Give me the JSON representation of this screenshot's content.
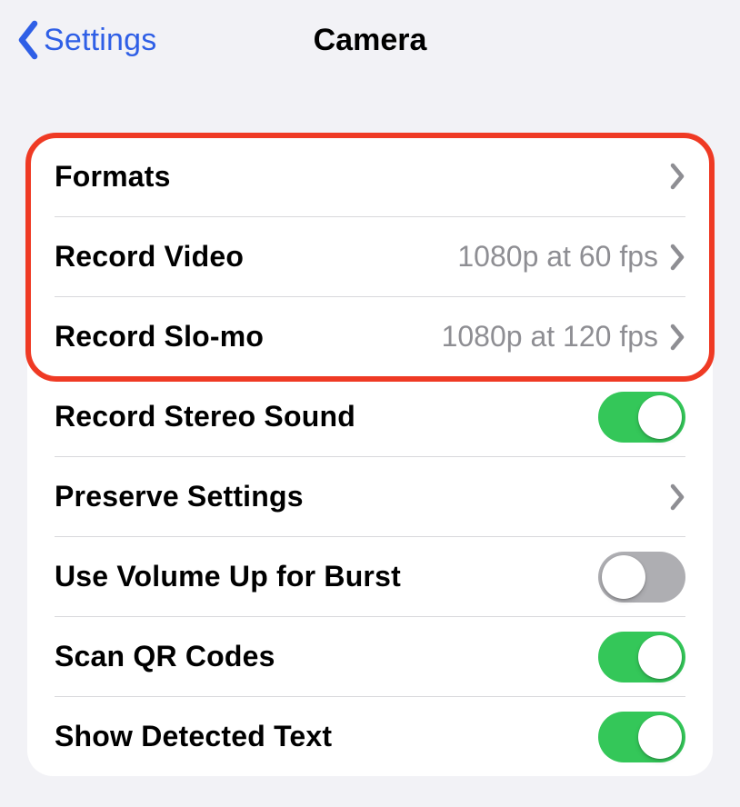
{
  "navbar": {
    "back_label": "Settings",
    "title": "Camera"
  },
  "rows": {
    "formats": {
      "label": "Formats",
      "value": ""
    },
    "record_video": {
      "label": "Record Video",
      "value": "1080p at 60 fps"
    },
    "record_slomo": {
      "label": "Record Slo-mo",
      "value": "1080p at 120 fps"
    },
    "stereo_sound": {
      "label": "Record Stereo Sound",
      "on": true
    },
    "preserve": {
      "label": "Preserve Settings",
      "value": ""
    },
    "volume_burst": {
      "label": "Use Volume Up for Burst",
      "on": false
    },
    "scan_qr": {
      "label": "Scan QR Codes",
      "on": true
    },
    "detected_text": {
      "label": "Show Detected Text",
      "on": true
    }
  },
  "colors": {
    "accent_blue": "#2f5fe6",
    "switch_green": "#34c759",
    "switch_gray": "#aeaeb2",
    "value_gray": "#8e8e93",
    "highlight_red": "#ef3a24"
  }
}
